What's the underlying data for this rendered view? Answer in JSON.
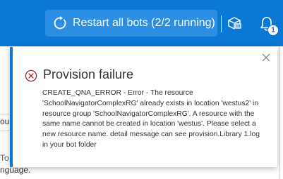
{
  "header": {
    "restart_button_label": "Restart all bots (2/2 running)",
    "notification_count": "1",
    "icons": {
      "restart": "restart-icon",
      "publish": "publish-icon",
      "notifications": "bell-icon"
    }
  },
  "background": {
    "fragment_ou": "ou",
    "fragment_to": "To",
    "fragment_language": "nguage."
  },
  "notification": {
    "title": "Provision failure",
    "message": "CREATE_QNA_ERROR - Error - The resource 'SchoolNavigatorComplexRG' already exists in location 'westus2' in resource group 'SchoolNavigatorComplexRG'. A resource with the same name cannot be created in location 'westus'. Please select a new resource name. detail message can see provision.Library 1.log in your bot folder",
    "icons": {
      "status": "error-icon",
      "dismiss": "close-icon"
    }
  },
  "colors": {
    "header": "#0a78d4",
    "button": "#2b8ee2",
    "error": "#a4262c",
    "accent": "#0a78d4"
  }
}
